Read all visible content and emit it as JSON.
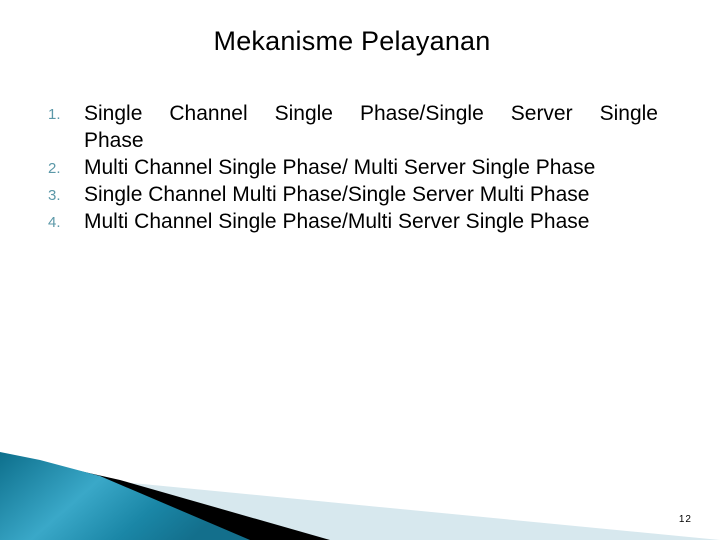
{
  "slide": {
    "title": "Mekanisme Pelayanan",
    "items": [
      {
        "number": "1.",
        "text": "Single Channel Single Phase/Single Server Single Phase"
      },
      {
        "number": "2.",
        "text": "Multi Channel Single Phase/ Multi Server Single Phase"
      },
      {
        "number": "3.",
        "text": "Single Channel Multi Phase/Single Server Multi Phase"
      },
      {
        "number": "4.",
        "text": "Multi Channel Single Phase/Multi Server Single Phase"
      }
    ],
    "page_number": "12"
  },
  "theme": {
    "accent_blue": "#1a86a6",
    "accent_light_blue": "#d7e8ee",
    "number_color": "#5b98a8"
  }
}
